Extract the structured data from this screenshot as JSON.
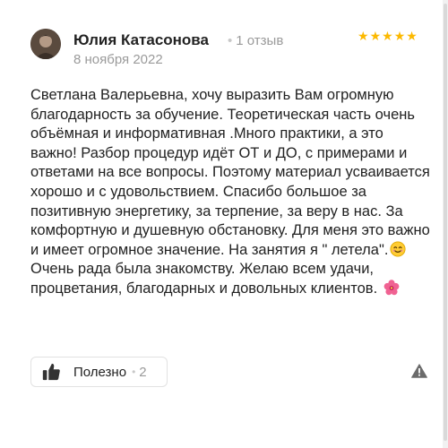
{
  "review": {
    "author": "Юлия Катасонова",
    "review_count": "1 отзыв",
    "date": "8 ноября 2022",
    "rating_stars": 5,
    "text_part1": "Светлана Валерьевна, хочу выразить Вам огромную благодарность за обучение. Теоретическая часть очень объёмная и информативная .Много практики, а это важно! Разбор процедур идёт ОТ и ДО, с примерами и ответами на все вопросы. Поэтому материал усваивается хорошо и с удовольствием. Спасибо большое за позитивную энергетику, за терпение, за веру в нас. За комфортную и душевную обстановку. Для меня это важно и имеет огромное значение. На занятия я \" летела\".",
    "text_part2": " Очень рада была знакомству. Желаю всем удачи, процветания, благодарных и довольных клиентов. ",
    "emoji1": "smiling-face-emoji",
    "emoji2": "hibiscus-flower-emoji"
  },
  "actions": {
    "useful_label": "Полезно",
    "useful_count": "2",
    "report_icon": "warning-triangle-icon"
  },
  "colors": {
    "star": "#fcb900",
    "secondary_text": "#9a9a9a",
    "primary_text": "#222222"
  }
}
